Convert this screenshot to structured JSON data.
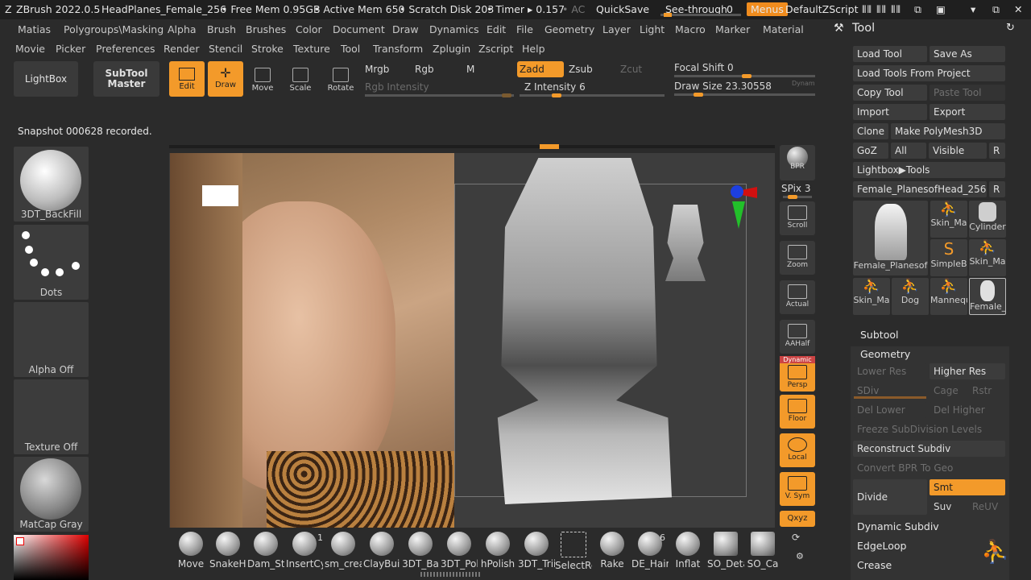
{
  "titlebar": {
    "app": "ZBrush 2022.0.5",
    "file": "HeadPlanes_Female_256",
    "free_mem": "• Free Mem 0.95GB",
    "active_mem": "• Active Mem 650",
    "scratch": "• Scratch Disk 203",
    "timer": "• Timer ▸ 0.157",
    "ac": "• AC",
    "quicksave": "QuickSave",
    "see_through_label": "See-through",
    "see_through_value": "0",
    "menus": "Menus",
    "script": "DefaultZScript"
  },
  "menu_row1": [
    "Matias",
    "Polygroups\\Masking",
    "Alpha",
    "Brush",
    "Brushes",
    "Color",
    "Document",
    "Draw",
    "Dynamics",
    "Edit",
    "File",
    "Geometry",
    "Layer",
    "Light",
    "Macro",
    "Marker",
    "Material"
  ],
  "menu_row2": [
    "Movie",
    "Picker",
    "Preferences",
    "Render",
    "Stencil",
    "Stroke",
    "Texture",
    "Tool",
    "Transform",
    "Zplugin",
    "Zscript",
    "Help"
  ],
  "toolbar": {
    "lightbox": "LightBox",
    "subtool_master": "SubTool\nMaster",
    "edit": "Edit",
    "draw": "Draw",
    "move": "Move",
    "scale": "Scale",
    "rotate": "Rotate",
    "mrgb": "Mrgb",
    "rgb": "Rgb",
    "m": "M",
    "rgb_intensity": "Rgb Intensity",
    "zadd": "Zadd",
    "zsub": "Zsub",
    "zcut": "Zcut",
    "z_intensity": "Z Intensity 6",
    "focal_shift": "Focal Shift 0",
    "draw_size": "Draw Size 23.30558",
    "dynamic": "Dynam"
  },
  "status": "Snapshot 000628 recorded.",
  "shelf": {
    "material": "3DT_BackFill",
    "stroke": "Dots",
    "alpha": "Alpha Off",
    "texture": "Texture Off",
    "matcap": "MatCap Gray"
  },
  "nav": {
    "bpr": "BPR",
    "spix": "SPix 3",
    "scroll": "Scroll",
    "zoom": "Zoom",
    "actual": "Actual",
    "aahalf": "AAHalf",
    "persp": "Persp",
    "floor": "Floor",
    "local": "Local",
    "vsym": "V. Sym",
    "xyz": "Qxyz",
    "dynamic_top": "Dynamic"
  },
  "tool_panel": {
    "title": "Tool",
    "load_tool": "Load Tool",
    "save_as": "Save As",
    "load_from_project": "Load Tools From Project",
    "copy_tool": "Copy Tool",
    "paste_tool": "Paste Tool",
    "import": "Import",
    "export": "Export",
    "clone": "Clone",
    "make_polymesh": "Make PolyMesh3D",
    "goz": "GoZ",
    "all": "All",
    "visible": "Visible",
    "r": "R",
    "lightbox_tools": "Lightbox▶Tools",
    "current_tool": "Female_PlanesofHead_256.",
    "thumbs": [
      "Female_Planesof",
      "Skin_Ma",
      "Cylinder",
      "SimpleB",
      "Skin_Ma",
      "Skin_Ma",
      "Dog",
      "Mannequ",
      "Female_"
    ],
    "subtool": "Subtool",
    "geometry": "Geometry",
    "lower_res": "Lower Res",
    "higher_res": "Higher Res",
    "sdiv": "SDiv",
    "cage": "Cage",
    "rstr": "Rstr",
    "del_lower": "Del Lower",
    "del_higher": "Del Higher",
    "freeze": "Freeze SubDivision Levels",
    "reconstruct": "Reconstruct Subdiv",
    "convert_bpr": "Convert BPR To Geo",
    "divide": "Divide",
    "smt": "Smt",
    "suv": "Suv",
    "reuv": "ReUV",
    "dynamic_subdiv": "Dynamic Subdiv",
    "edgeloop": "EdgeLoop",
    "crease": "Crease"
  },
  "brushes": [
    "Move",
    "SnakeHo",
    "Dam_Sta",
    "InsertCy",
    "sm_crea",
    "ClayBuil",
    "3DT_Ba",
    "3DT_Pol",
    "hPolish",
    "3DT_Trii",
    "SelectRe",
    "Rake",
    "DE_Hair",
    "Inflat",
    "SO_Deta",
    "SO_Ca"
  ],
  "brush_badges": {
    "insert": "1",
    "dehair": "6"
  },
  "colors": {
    "accent": "#f39a2a",
    "bg": "#2b2b2b",
    "panel": "#3c3c3c"
  }
}
